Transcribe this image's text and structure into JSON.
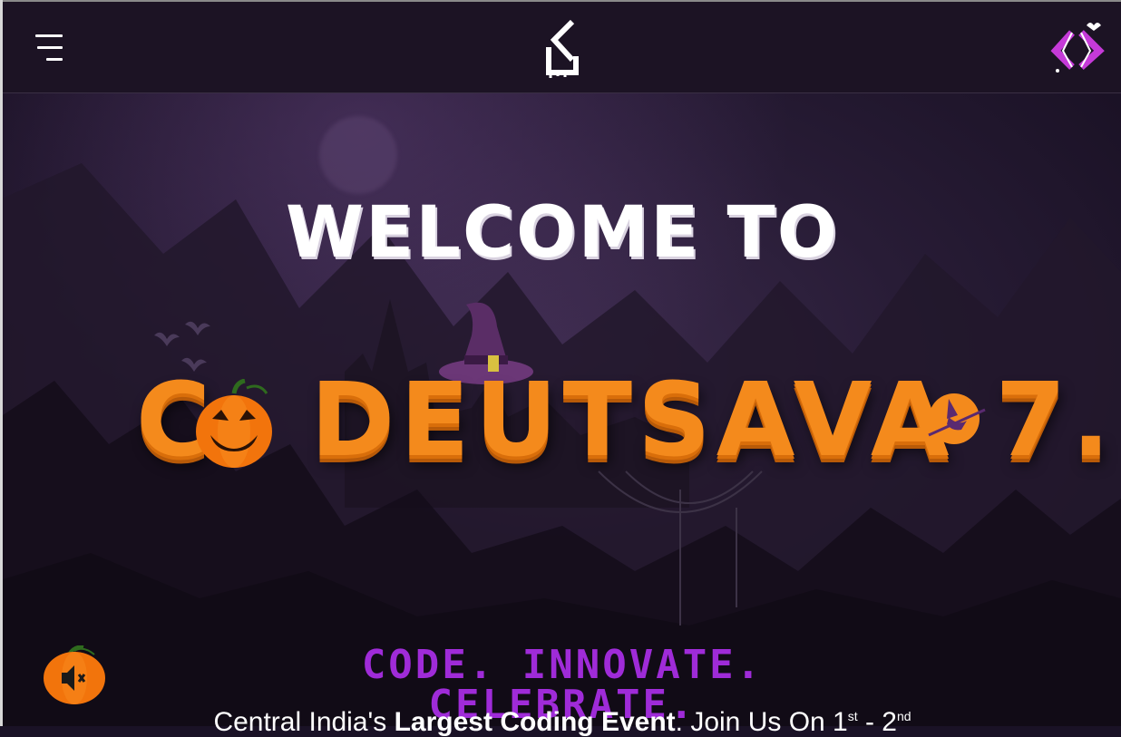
{
  "header": {
    "menu_icon": "hamburger-menu-icon",
    "center_logo_icon": "codeutsava-logo-icon",
    "right_logo_icon": "club-logo-icon"
  },
  "hero": {
    "welcome_text": "WELCOME TO",
    "title_pre": "C",
    "title_post": "DEUTSAVA 7.",
    "tagline": "CODE. INNOVATE. CELEBRATE.",
    "subtext_start": "Central India's ",
    "subtext_bold": "Largest Coding Event",
    "subtext_join": ". Join Us On 1",
    "subtext_sup1": "st",
    "subtext_mid": " - 2",
    "subtext_sup2": "nd"
  },
  "decorations": {
    "pumpkin_icon": "jack-o-lantern-icon",
    "hat_icon": "witch-hat-icon",
    "bats_icon": "bats-icon",
    "witch_icon": "flying-witch-icon"
  },
  "audio": {
    "mute_icon": "speaker-muted-icon"
  },
  "colors": {
    "accent_orange": "#f48a1c",
    "accent_purple": "#9f2bd8",
    "header_bg": "#1c1324"
  }
}
